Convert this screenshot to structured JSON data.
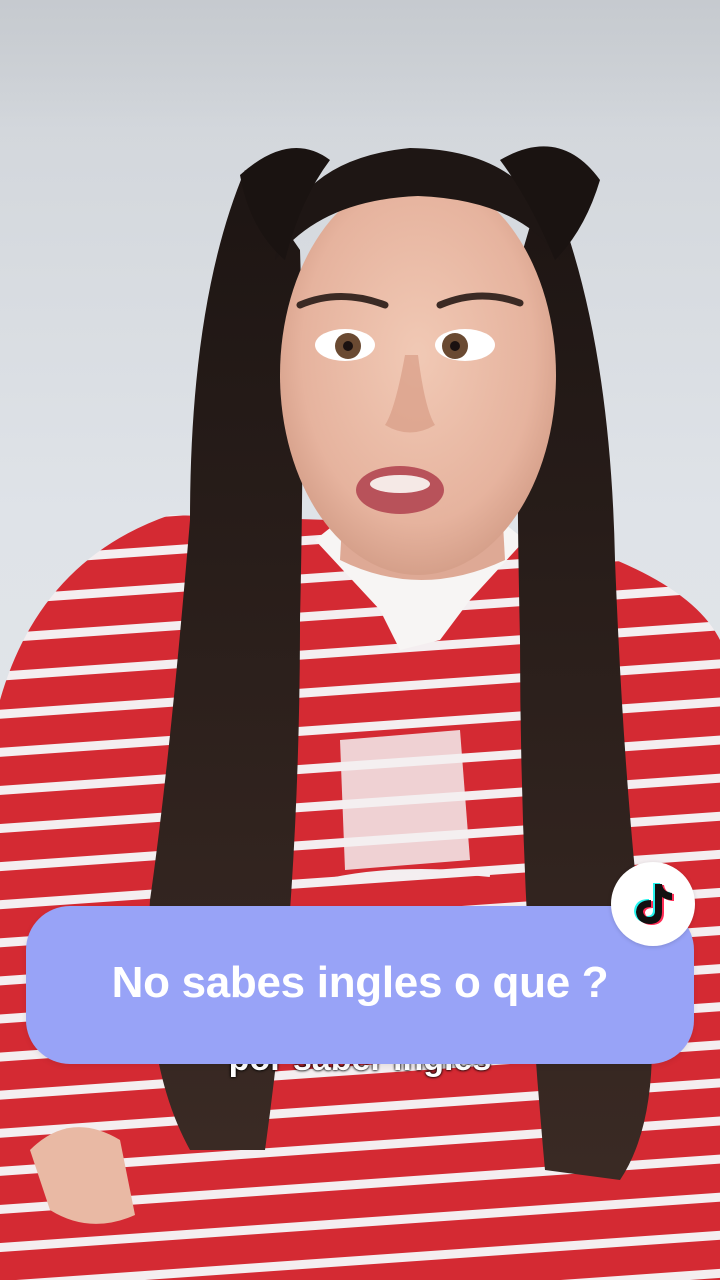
{
  "caption": {
    "bubble_text": "No sabes ingles o que ?",
    "underlying_subtitle": "por saber ingles"
  },
  "icons": {
    "brand": "tiktok-logo-icon"
  },
  "colors": {
    "bubble": "#98a3f7",
    "bubble_text": "#ffffff",
    "shirt_red": "#d42a33",
    "hair": "#241a17",
    "wall": "#dfe3e8"
  }
}
